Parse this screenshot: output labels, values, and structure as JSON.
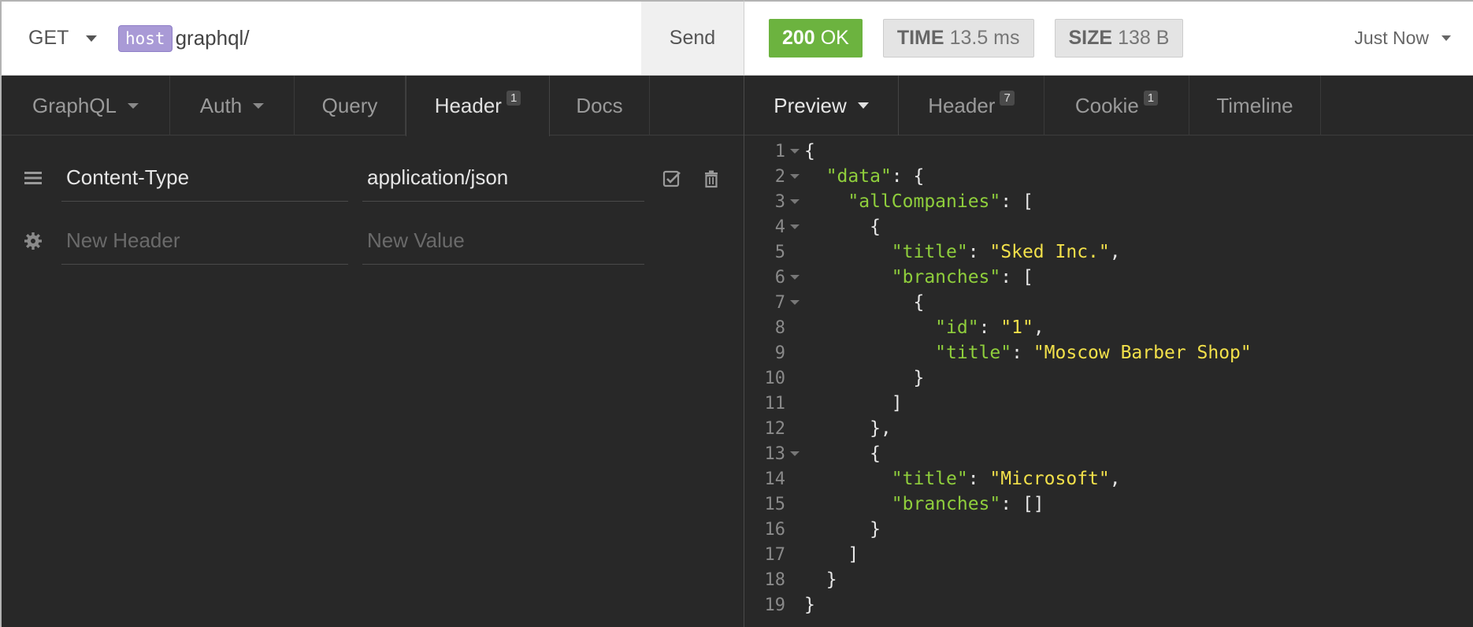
{
  "request": {
    "method": "GET",
    "host_tag": "host",
    "path": "graphql/",
    "send_label": "Send"
  },
  "response": {
    "status_code": "200",
    "status_text": "OK",
    "time_label": "TIME",
    "time_value": "13.5 ms",
    "size_label": "SIZE",
    "size_value": "138 B",
    "history_label": "Just Now"
  },
  "left_tabs": [
    {
      "label": "GraphQL",
      "dropdown": true
    },
    {
      "label": "Auth",
      "dropdown": true
    },
    {
      "label": "Query"
    },
    {
      "label": "Header",
      "badge": "1",
      "active": true
    },
    {
      "label": "Docs"
    }
  ],
  "headers": [
    {
      "name": "Content-Type",
      "value": "application/json",
      "enabled": true
    }
  ],
  "new_header": {
    "name_placeholder": "New Header",
    "value_placeholder": "New Value"
  },
  "right_tabs": [
    {
      "label": "Preview",
      "dropdown": true,
      "active": true
    },
    {
      "label": "Header",
      "badge": "7"
    },
    {
      "label": "Cookie",
      "badge": "1"
    },
    {
      "label": "Timeline"
    }
  ],
  "code_lines": [
    {
      "n": "1",
      "fold": true,
      "tokens": [
        [
          "p",
          "{"
        ]
      ]
    },
    {
      "n": "2",
      "fold": true,
      "tokens": [
        [
          "p",
          "  "
        ],
        [
          "k",
          "\"data\""
        ],
        [
          "p",
          ": {"
        ]
      ]
    },
    {
      "n": "3",
      "fold": true,
      "tokens": [
        [
          "p",
          "    "
        ],
        [
          "k",
          "\"allCompanies\""
        ],
        [
          "p",
          ": ["
        ]
      ]
    },
    {
      "n": "4",
      "fold": true,
      "tokens": [
        [
          "p",
          "      {"
        ]
      ]
    },
    {
      "n": "5",
      "fold": false,
      "tokens": [
        [
          "p",
          "        "
        ],
        [
          "k",
          "\"title\""
        ],
        [
          "p",
          ": "
        ],
        [
          "s",
          "\"Sked Inc.\""
        ],
        [
          "p",
          ","
        ]
      ]
    },
    {
      "n": "6",
      "fold": true,
      "tokens": [
        [
          "p",
          "        "
        ],
        [
          "k",
          "\"branches\""
        ],
        [
          "p",
          ": ["
        ]
      ]
    },
    {
      "n": "7",
      "fold": true,
      "tokens": [
        [
          "p",
          "          {"
        ]
      ]
    },
    {
      "n": "8",
      "fold": false,
      "tokens": [
        [
          "p",
          "            "
        ],
        [
          "k",
          "\"id\""
        ],
        [
          "p",
          ": "
        ],
        [
          "s",
          "\"1\""
        ],
        [
          "p",
          ","
        ]
      ]
    },
    {
      "n": "9",
      "fold": false,
      "tokens": [
        [
          "p",
          "            "
        ],
        [
          "k",
          "\"title\""
        ],
        [
          "p",
          ": "
        ],
        [
          "s",
          "\"Moscow Barber Shop\""
        ]
      ]
    },
    {
      "n": "10",
      "fold": false,
      "tokens": [
        [
          "p",
          "          }"
        ]
      ]
    },
    {
      "n": "11",
      "fold": false,
      "tokens": [
        [
          "p",
          "        ]"
        ]
      ]
    },
    {
      "n": "12",
      "fold": false,
      "tokens": [
        [
          "p",
          "      },"
        ]
      ]
    },
    {
      "n": "13",
      "fold": true,
      "tokens": [
        [
          "p",
          "      {"
        ]
      ]
    },
    {
      "n": "14",
      "fold": false,
      "tokens": [
        [
          "p",
          "        "
        ],
        [
          "k",
          "\"title\""
        ],
        [
          "p",
          ": "
        ],
        [
          "s",
          "\"Microsoft\""
        ],
        [
          "p",
          ","
        ]
      ]
    },
    {
      "n": "15",
      "fold": false,
      "tokens": [
        [
          "p",
          "        "
        ],
        [
          "k",
          "\"branches\""
        ],
        [
          "p",
          ": []"
        ]
      ]
    },
    {
      "n": "16",
      "fold": false,
      "tokens": [
        [
          "p",
          "      }"
        ]
      ]
    },
    {
      "n": "17",
      "fold": false,
      "tokens": [
        [
          "p",
          "    ]"
        ]
      ]
    },
    {
      "n": "18",
      "fold": false,
      "tokens": [
        [
          "p",
          "  }"
        ]
      ]
    },
    {
      "n": "19",
      "fold": false,
      "tokens": [
        [
          "p",
          "}"
        ]
      ]
    }
  ],
  "colors": {
    "status_ok": "#6cb33f",
    "json_key": "#8fce3c",
    "json_string": "#f2e04a",
    "host_tag": "#a99ad6"
  },
  "icons": {
    "drag_handle": "hamburger-icon",
    "settings": "gear-icon",
    "enable_checkbox": "checkbox-checked-icon",
    "delete": "trash-icon",
    "dropdown": "chevron-down-icon"
  }
}
